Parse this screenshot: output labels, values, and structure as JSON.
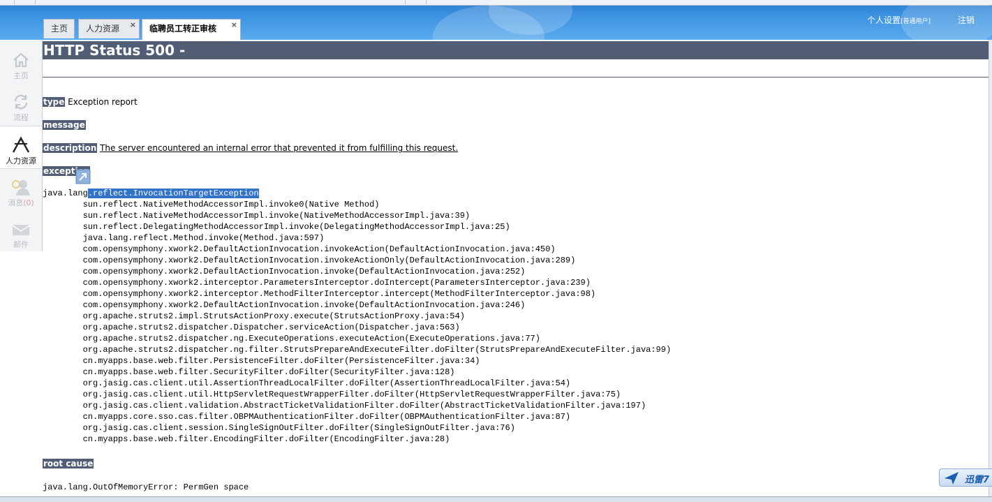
{
  "header": {
    "personal_settings": "个人设置",
    "user_type": "[普通用户]",
    "logout": "注销"
  },
  "tabs": [
    {
      "label": "主页"
    },
    {
      "label": "人力资源"
    },
    {
      "label": "临聘员工转正审核"
    }
  ],
  "sidebar": {
    "items": [
      {
        "label": "主页",
        "icon": "home-icon"
      },
      {
        "label": "流程",
        "icon": "workflow-icon"
      },
      {
        "label": "人力资源",
        "icon": "hr-icon"
      },
      {
        "label": "消息",
        "count": "(0)",
        "icon": "message-icon"
      },
      {
        "label": "邮件",
        "icon": "mail-icon"
      }
    ]
  },
  "error": {
    "title": "HTTP Status 500 -",
    "type_label": "type",
    "type_value": "Exception report",
    "message_label": "message",
    "description_label": "description",
    "description_value": "The server encountered an internal error that prevented it from fulfilling this request.",
    "exception_label": "exception",
    "exception_prefix": "java.lang",
    "exception_selected": ".reflect.InvocationTargetException",
    "stack": [
      "sun.reflect.NativeMethodAccessorImpl.invoke0(Native Method)",
      "sun.reflect.NativeMethodAccessorImpl.invoke(NativeMethodAccessorImpl.java:39)",
      "sun.reflect.DelegatingMethodAccessorImpl.invoke(DelegatingMethodAccessorImpl.java:25)",
      "java.lang.reflect.Method.invoke(Method.java:597)",
      "com.opensymphony.xwork2.DefaultActionInvocation.invokeAction(DefaultActionInvocation.java:450)",
      "com.opensymphony.xwork2.DefaultActionInvocation.invokeActionOnly(DefaultActionInvocation.java:289)",
      "com.opensymphony.xwork2.DefaultActionInvocation.invoke(DefaultActionInvocation.java:252)",
      "com.opensymphony.xwork2.interceptor.ParametersInterceptor.doIntercept(ParametersInterceptor.java:239)",
      "com.opensymphony.xwork2.interceptor.MethodFilterInterceptor.intercept(MethodFilterInterceptor.java:98)",
      "com.opensymphony.xwork2.DefaultActionInvocation.invoke(DefaultActionInvocation.java:246)",
      "org.apache.struts2.impl.StrutsActionProxy.execute(StrutsActionProxy.java:54)",
      "org.apache.struts2.dispatcher.Dispatcher.serviceAction(Dispatcher.java:563)",
      "org.apache.struts2.dispatcher.ng.ExecuteOperations.executeAction(ExecuteOperations.java:77)",
      "org.apache.struts2.dispatcher.ng.filter.StrutsPrepareAndExecuteFilter.doFilter(StrutsPrepareAndExecuteFilter.java:99)",
      "cn.myapps.base.web.filter.PersistenceFilter.doFilter(PersistenceFilter.java:34)",
      "cn.myapps.base.web.filter.SecurityFilter.doFilter(SecurityFilter.java:128)",
      "org.jasig.cas.client.util.AssertionThreadLocalFilter.doFilter(AssertionThreadLocalFilter.java:54)",
      "org.jasig.cas.client.util.HttpServletRequestWrapperFilter.doFilter(HttpServletRequestWrapperFilter.java:75)",
      "org.jasig.cas.client.validation.AbstractTicketValidationFilter.doFilter(AbstractTicketValidationFilter.java:197)",
      "cn.myapps.core.sso.cas.filter.OBPMAuthenticationFilter.doFilter(OBPMAuthenticationFilter.java:87)",
      "org.jasig.cas.client.session.SingleSignOutFilter.doFilter(SingleSignOutFilter.java:76)",
      "cn.myapps.base.web.filter.EncodingFilter.doFilter(EncodingFilter.java:28)"
    ],
    "root_cause_label": "root cause",
    "root_cause_value": "java.lang.OutOfMemoryError: PermGen space"
  },
  "tray": {
    "xunlei_label": "迅雷7"
  },
  "colors": {
    "header_bar": "#525d76",
    "selection": "#3173c9",
    "banner_blue": "#3f95e3"
  }
}
